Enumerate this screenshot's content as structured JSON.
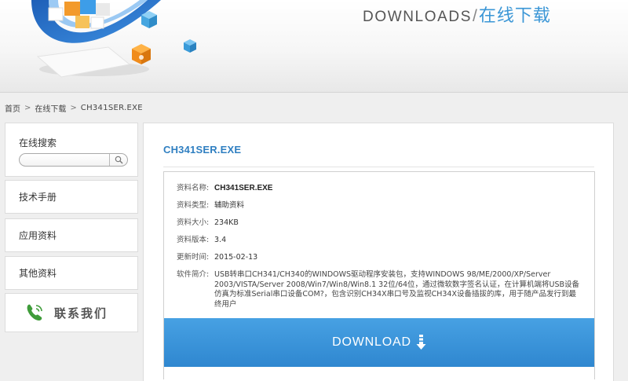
{
  "banner": {
    "title_en": "DOWNLOADS",
    "separator": "/",
    "title_cn": "在线下载",
    "accent_color": "#3a96d6"
  },
  "breadcrumb": {
    "items": [
      "首页",
      "在线下载",
      "CH341SER.EXE"
    ],
    "separator": ">"
  },
  "sidebar": {
    "search": {
      "label": "在线搜索",
      "placeholder": "",
      "value": "",
      "button_icon": "search-icon"
    },
    "links": [
      "技术手册",
      "应用资料",
      "其他资料"
    ],
    "contact": {
      "label": "联系我们",
      "icon": "phone-icon"
    }
  },
  "main": {
    "title": "CH341SER.EXE",
    "title_color": "#2f7fc1",
    "details": [
      {
        "key": "资料名称:",
        "value": "CH341SER.EXE"
      },
      {
        "key": "资料类型:",
        "value": "辅助资料"
      },
      {
        "key": "资料大小:",
        "value": "234KB"
      },
      {
        "key": "资料版本:",
        "value": "3.4"
      },
      {
        "key": "更新时间:",
        "value": "2015-02-13"
      },
      {
        "key": "软件简介:",
        "value": "USB转串口CH341/CH340的WINDOWS驱动程序安装包，支持WINDOWS 98/ME/2000/XP/Server 2003/VISTA/Server 2008/Win7/Win8/Win8.1 32位/64位，通过微软数字签名认证，在计算机端将USB设备仿真为标准Serial串口设备COM?，包含识别CH34X串口号及监视CH34X设备插拔的库，用于随产品发行到最终用户"
      }
    ],
    "download": {
      "label": "DOWNLOAD",
      "icon": "download-arrow-icon",
      "color": "#3b93da"
    }
  }
}
